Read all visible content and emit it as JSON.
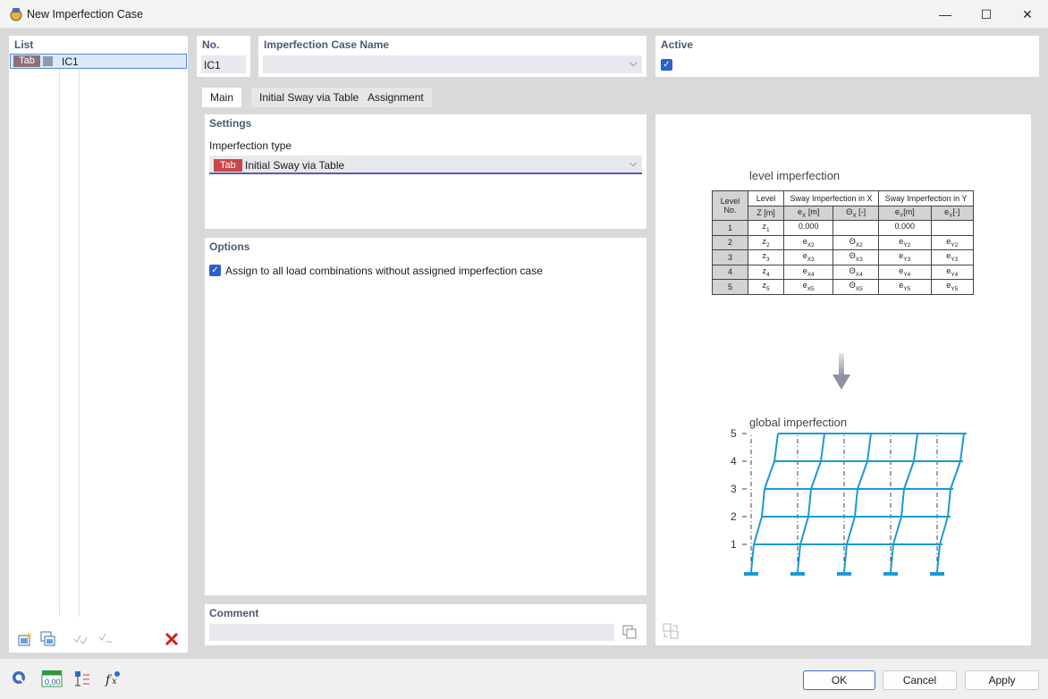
{
  "window": {
    "title": "New Imperfection Case",
    "icon": "imperfection-case-icon"
  },
  "list": {
    "header": "List",
    "items": [
      {
        "tag": "Tab",
        "name": "IC1",
        "color": "#8c9aab"
      }
    ]
  },
  "number": {
    "label": "No.",
    "value": "IC1"
  },
  "name": {
    "label": "Imperfection Case Name",
    "value": ""
  },
  "active": {
    "label": "Active",
    "checked": true
  },
  "tabs": [
    "Main",
    "Initial Sway via Table",
    "Assignment"
  ],
  "settings": {
    "header": "Settings",
    "type_label": "Imperfection type",
    "type_tag": "Tab",
    "type_value": "Initial Sway via Table"
  },
  "options": {
    "header": "Options",
    "assign_label": "Assign to all load combinations without assigned imperfection case",
    "assign_checked": true
  },
  "comment": {
    "label": "Comment",
    "value": ""
  },
  "diagram": {
    "level_title": "level imperfection",
    "global_title": "global imperfection",
    "table": {
      "h_level_no": "Level No.",
      "h_level": "Level",
      "h_sway_x": "Sway Imperfection in X",
      "h_sway_y": "Sway Imperfection in Y",
      "h_z": "Z [m]",
      "h_ex": "e",
      "h_ex_sub": "X",
      "h_ex_unit": " [m]",
      "h_thx": "Θ",
      "h_thx_sub": "X",
      "h_thx_unit": " [-]",
      "h_ey": "e",
      "h_ey_sub": "Y",
      "h_ey_unit": "[m]",
      "h_thy": "e",
      "h_thy_sub": "Y",
      "h_thy_unit": "[-]",
      "rows": [
        {
          "no": "1",
          "z": "z",
          "zs": "1",
          "ex": "0.000",
          "exs": "",
          "thx": "",
          "thxs": "",
          "ey": "0.000",
          "eys": "",
          "thy": "",
          "thys": ""
        },
        {
          "no": "2",
          "z": "z",
          "zs": "2",
          "ex": "e",
          "exs": "X2",
          "thx": "Θ",
          "thxs": "X2",
          "ey": "e",
          "eys": "Y2",
          "thy": "e",
          "thys": "Y2"
        },
        {
          "no": "3",
          "z": "z",
          "zs": "3",
          "ex": "e",
          "exs": "X3",
          "thx": "Θ",
          "thxs": "X3",
          "ey": "e",
          "eys": "Y3",
          "thy": "e",
          "thys": "Y3"
        },
        {
          "no": "4",
          "z": "z",
          "zs": "4",
          "ex": "e",
          "exs": "X4",
          "thx": "Θ",
          "thxs": "X4",
          "ey": "e",
          "eys": "Y4",
          "thy": "e",
          "thys": "Y4"
        },
        {
          "no": "5",
          "z": "z",
          "zs": "5",
          "ex": "e",
          "exs": "X5",
          "thx": "Θ",
          "thxs": "X5",
          "ey": "e",
          "eys": "Y5",
          "thy": "e",
          "thys": "Y5"
        }
      ]
    },
    "levels": [
      "5",
      "4",
      "3",
      "2",
      "1"
    ],
    "frame_color": "#1a9ad6"
  },
  "buttons": {
    "ok": "OK",
    "cancel": "Cancel",
    "apply": "Apply"
  }
}
